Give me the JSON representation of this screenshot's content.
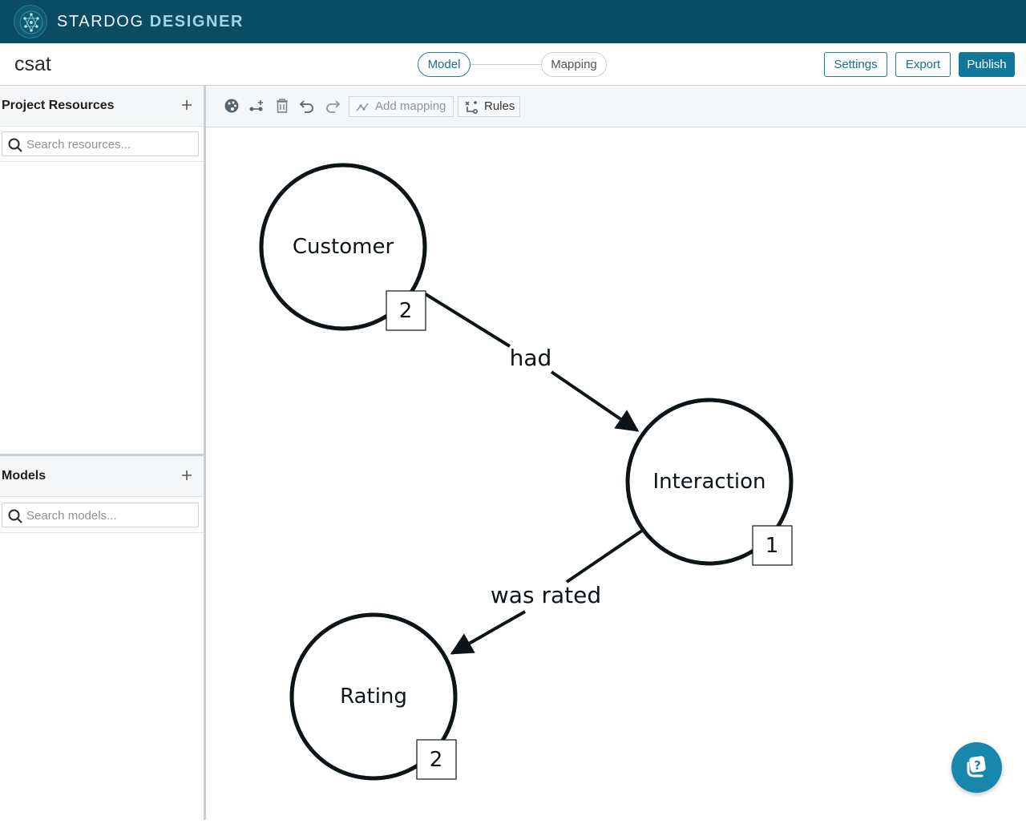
{
  "app": {
    "brand_light": "STARDOG",
    "brand_bold": "DESIGNER"
  },
  "header": {
    "project_name": "csat",
    "steps": [
      {
        "label": "Model",
        "active": true
      },
      {
        "label": "Mapping",
        "active": false
      }
    ],
    "settings_label": "Settings",
    "export_label": "Export",
    "publish_label": "Publish"
  },
  "sidebar": {
    "resources": {
      "title": "Project Resources",
      "add_icon": "plus-icon",
      "search_placeholder": "Search resources..."
    },
    "models": {
      "title": "Models",
      "add_icon": "plus-icon",
      "search_placeholder": "Search models..."
    }
  },
  "toolbar": {
    "icons": [
      "palette-icon",
      "add-edge-icon",
      "trash-icon",
      "undo-icon",
      "redo-icon"
    ],
    "add_mapping_label": "Add mapping",
    "rules_label": "Rules"
  },
  "graph": {
    "nodes": [
      {
        "id": "customer",
        "label": "Customer",
        "count": "2"
      },
      {
        "id": "interaction",
        "label": "Interaction",
        "count": "1"
      },
      {
        "id": "rating",
        "label": "Rating",
        "count": "2"
      }
    ],
    "edges": [
      {
        "from": "customer",
        "to": "interaction",
        "label": "had"
      },
      {
        "from": "interaction",
        "to": "rating",
        "label": "was rated"
      }
    ]
  },
  "colors": {
    "appbar": "#0a4c63",
    "accent": "#1b7fa1",
    "publish": "#0f7799",
    "help": "#1787ad"
  }
}
